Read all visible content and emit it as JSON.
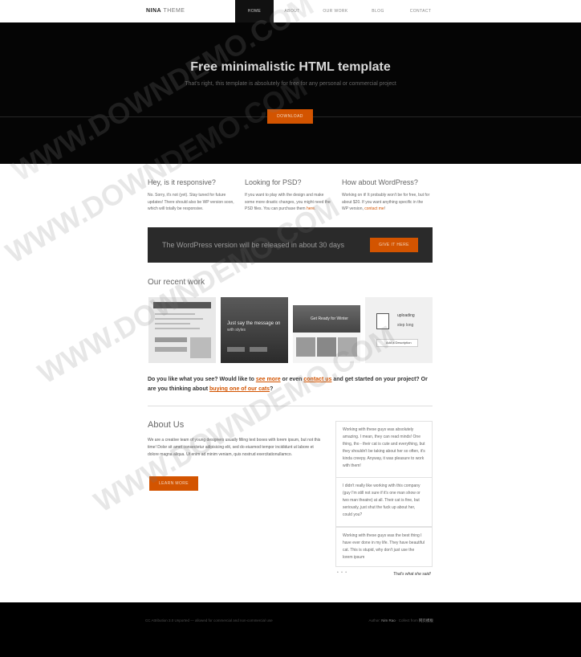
{
  "brand": {
    "strong": "NINA",
    "light": " THEME"
  },
  "nav": [
    "HOME",
    "ABOUT",
    "OUR WORK",
    "BLOG",
    "CONTACT"
  ],
  "hero": {
    "title": "Free minimalistic HTML template",
    "subtitle": "That's right, this template is absolutely for free for any personal or commercial project",
    "button": "DOWNLOAD"
  },
  "columns": [
    {
      "title": "Hey, is it responsive?",
      "text": "No. Sorry, it's not (yet). Stay tuned for future updates! There should also be WP version soon, which will totally be responsive.",
      "link": ""
    },
    {
      "title": "Looking for PSD?",
      "text": "If you want to play with the design and make some more drastic changes, you might need the PSD files. You can purchase them ",
      "link": "here"
    },
    {
      "title": "How about WordPress?",
      "text": "Working on it! It probably won't be for free, but for about $20. If you want anything specific in the WP version, ",
      "link": "contact me"
    }
  ],
  "banner": {
    "text": "The WordPress version will be released in about 30 days",
    "button": "GIVE IT HERE"
  },
  "recent_work": {
    "title": "Our recent work",
    "thumb2_title": "Just say the message on",
    "thumb2_sub": "with styles",
    "thumb3_title": "Get Ready for Winter",
    "thumb4_line1": "uploading",
    "thumb4_line2": "step long",
    "thumb4_btn": "Add a Description"
  },
  "cta": {
    "prefix": "Do you like what you see? Would like to ",
    "link1": "see more",
    "mid1": " or even ",
    "link2": "contact us",
    "mid2": " and get started on your project? Or are you thinking about ",
    "link3": "buying one of our cats",
    "suffix": "?"
  },
  "about": {
    "title": "About Us",
    "text": "We are a creative team of young designers usually filling text boxes with lorem ipsum, but not this time! Dolor sit amet consectetur adipisicing elit, sed do eiusmod tempor incididunt ut labore et dolore magna aliqua. Ut enim ad minim veniam, quis nostrud exercitationullamco.",
    "button": "LEARN MORE"
  },
  "testimonials": [
    "Working with these guys was absolutely amazing. I mean, they can read minds! One thing, tho - their cat is cute and everything, but they shouldn't be taking about her so often, it's kinda creepy. Anyway, it was pleasure to work with them!",
    "I didn't really like working with this company (guy I'm still not sure if it's one man show or two man theatre) at all. Their cat is fine, but seriously, just shut the fuck up about her, could you?",
    "Working with these guys was the best thing I have ever done in my life. They have beautiful cat. This is stupid, why don't just use the lorem ipsum"
  ],
  "testimonial_dots": "• • •",
  "testimonial_tag": "That's what she said!",
  "footer": {
    "left": "CC Attribution 3.0 Unported — allowed for commercial and non-commercial use",
    "right_label": "Author: ",
    "right_author": "Nim Rao",
    "right_mid": " · Collect from ",
    "right_site": "网页模板"
  },
  "watermark": "WWW.DOWNDEMO.COM"
}
